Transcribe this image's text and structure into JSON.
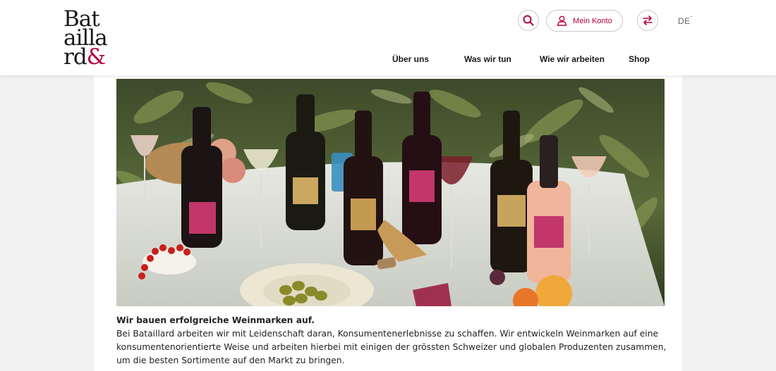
{
  "brand": {
    "logo_lines": [
      "Bat",
      "ailla",
      "rd"
    ],
    "logo_amp": "&"
  },
  "header": {
    "search_icon": "search-icon",
    "account_label": "Mein Konto",
    "account_icon": "user-icon",
    "switch_icon": "swap-arrows-icon",
    "language": "DE",
    "nav": [
      "Über uns",
      "Was wir tun",
      "Wie wir arbeiten",
      "Shop"
    ]
  },
  "hero": {
    "description": "Wine bottles and glasses on a white table with olives, fruit and greenery"
  },
  "intro": {
    "headline": "Wir bauen erfolgreiche Weinmarken auf.",
    "body": "Bei Bataillard arbeiten wir mit Leidenschaft daran, Konsumentenerlebnisse zu schaffen. Wir entwickeln Weinmarken auf eine konsumentenorientierte Weise und arbeiten hierbei mit einigen der grössten Schweizer und globalen Produzenten zusammen, um die besten Sortimente auf den Markt zu bringen."
  },
  "colors": {
    "accent": "#b3003a",
    "header_bg": "#ffffff",
    "page_bg": "#f2f2f2"
  }
}
